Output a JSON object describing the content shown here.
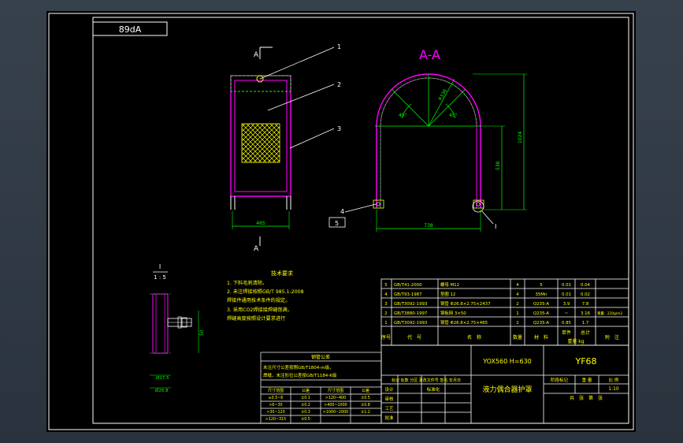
{
  "drawing": {
    "corner_code": "89dA",
    "section_label": "A-A",
    "cut_marker": "A",
    "detail_id": "I",
    "detail_scale": "1 : 5",
    "callouts": [
      "1",
      "2",
      "3",
      "4",
      "5"
    ],
    "dims": {
      "front_width": "465",
      "section_width": "738",
      "section_height": "1024",
      "section_inner": "538",
      "radius": "R336",
      "angle_a": "45°",
      "angle_b": "45°",
      "detail_height": "50",
      "detail_w1": "Ø27.5",
      "detail_w2": "Ø26.8"
    }
  },
  "notes": {
    "title": "技术要求",
    "lines": [
      "1. 下料毛刺清除。",
      "2. 未注焊接按照GB/T 985.1-2008",
      "   焊接件通用技术条件的规定。",
      "3. 采用CO2焊接接焊缝饱满，",
      "   焊缝高度按照设计要求进行"
    ]
  },
  "bom": {
    "rows": [
      {
        "no": "5",
        "code": "GB/T41-2000",
        "name": "螺母 M12",
        "qty": "4",
        "mat": "5",
        "w1": "0.01",
        "w2": "0.04",
        "note": ""
      },
      {
        "no": "4",
        "code": "GB/T93-1987",
        "name": "垫圈 12",
        "qty": "4",
        "mat": "35Mn",
        "w1": "0.01",
        "w2": "0.02",
        "note": ""
      },
      {
        "no": "3",
        "code": "GB/T3092-1993",
        "name": "钢管 Φ26.8×2.75×2437",
        "qty": "2",
        "mat": "Q235-A",
        "w1": "3.9",
        "w2": "7.8",
        "note": ""
      },
      {
        "no": "2",
        "code": "GB/T3880-1997",
        "name": "钢板网 3×50",
        "qty": "1",
        "mat": "Q235-A",
        "w1": "~",
        "w2": "3.16",
        "note": "重量：220g/m2"
      },
      {
        "no": "1",
        "code": "GB/T3092-1993",
        "name": "钢管 Φ26.8×2.75×465",
        "qty": "2",
        "mat": "Q235-A",
        "w1": "0.85",
        "w2": "1.7",
        "note": ""
      }
    ],
    "header": {
      "no": "序号",
      "code": "代　号",
      "name": "名　称",
      "qty": "数量",
      "mat": "材　料",
      "unit_w": "单件",
      "total_w": "总计",
      "weight": "重量 kg",
      "note": "附　注"
    }
  },
  "title_block": {
    "model": "YOX560 H=630",
    "code": "YF68",
    "title": "液力偶合器护罩",
    "stage_label": "阶段标记",
    "weight_label": "重 量",
    "scale_label": "比 例",
    "scale": "1:10",
    "sheet_label": "共　张　第　张",
    "revision_header": "标记 处数 分区 更改文件号 签名 年月日",
    "roles": [
      "设计",
      "审核",
      "工艺",
      "批准",
      "标准化"
    ]
  },
  "tolerance": {
    "title": "钢管公差",
    "lines": [
      "未注尺寸公差按照GB/T1804-m级，",
      "焊缝，未注形位公差按GB/T1184-K级"
    ],
    "header": [
      "尺寸范围",
      "公差",
      "尺寸范围",
      "公差"
    ],
    "rows": [
      [
        "≥0.5~6",
        "±0.1",
        ">120~400",
        "±0.5"
      ],
      [
        ">6~30",
        "±0.2",
        ">400~1000",
        "±0.8"
      ],
      [
        ">30~120",
        "±0.3",
        ">1000~2000",
        "±1.2"
      ],
      [
        ">120~315",
        "±0.5",
        "",
        ""
      ]
    ]
  },
  "colors": {
    "background": "#000000",
    "frame": "#ffffff",
    "accent": "#ff00ff",
    "text_yellow": "#ffff00",
    "line_green": "#00ff00",
    "leader_cyan": "#00ffff"
  }
}
